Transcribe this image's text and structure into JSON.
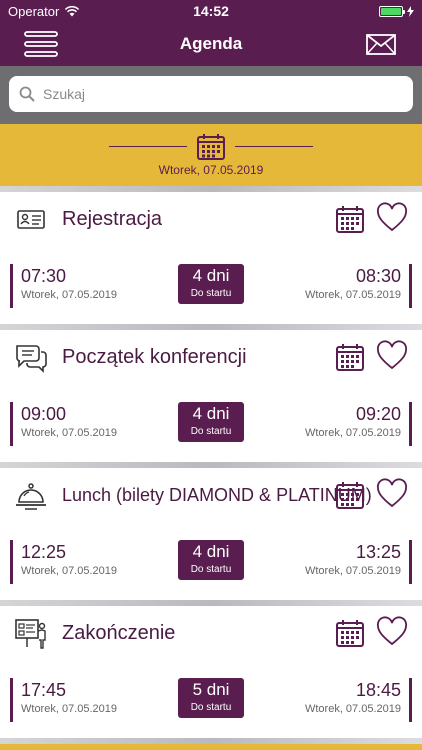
{
  "status_bar": {
    "carrier": "Operator",
    "time": "14:52"
  },
  "nav": {
    "title": "Agenda",
    "menu_icon": "hamburger-icon",
    "mail_icon": "envelope-icon"
  },
  "search": {
    "placeholder": "Szukaj"
  },
  "date_header": {
    "date": "Wtorek, 07.05.2019"
  },
  "colors": {
    "primary": "#5a1d4f",
    "accent": "#e6b83a",
    "search_bg": "#6e6e70"
  },
  "events": [
    {
      "title": "Rejestracja",
      "icon": "id-card-icon",
      "start_time": "07:30",
      "start_date": "Wtorek, 07.05.2019",
      "countdown_value": "4 dni",
      "countdown_label": "Do startu",
      "end_time": "08:30",
      "end_date": "Wtorek, 07.05.2019"
    },
    {
      "title": "Początek konferencji",
      "icon": "chat-bubbles-icon",
      "start_time": "09:00",
      "start_date": "Wtorek, 07.05.2019",
      "countdown_value": "4 dni",
      "countdown_label": "Do startu",
      "end_time": "09:20",
      "end_date": "Wtorek, 07.05.2019"
    },
    {
      "title": "Lunch (bilety DIAMOND & PLATINUM)",
      "icon": "food-cloche-icon",
      "start_time": "12:25",
      "start_date": "Wtorek, 07.05.2019",
      "countdown_value": "4 dni",
      "countdown_label": "Do startu",
      "end_time": "13:25",
      "end_date": "Wtorek, 07.05.2019"
    },
    {
      "title": "Zakończenie",
      "icon": "presentation-icon",
      "start_time": "17:45",
      "start_date": "Wtorek, 07.05.2019",
      "countdown_value": "5 dni",
      "countdown_label": "Do startu",
      "end_time": "18:45",
      "end_date": "Wtorek, 07.05.2019"
    }
  ]
}
